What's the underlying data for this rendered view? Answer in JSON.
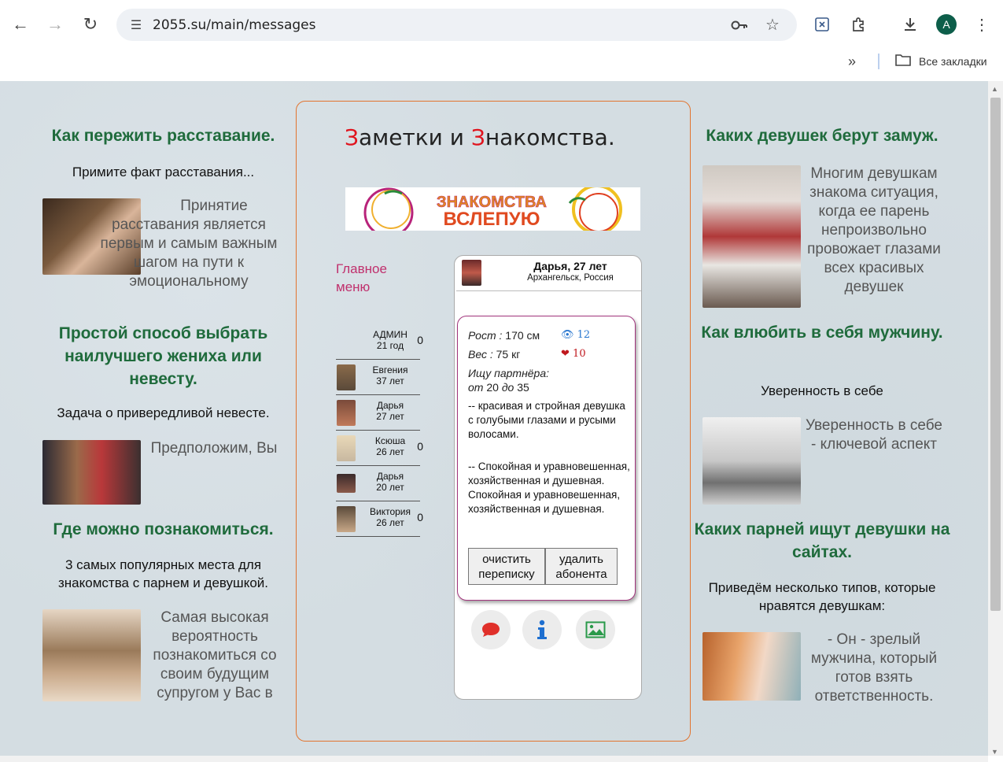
{
  "browser": {
    "url": "2055.su/main/messages",
    "bookmarks_label": "Все закладки",
    "profile_initial": "A"
  },
  "page": {
    "site_title_part1_first": "З",
    "site_title_part1_rest": "аметки и ",
    "site_title_part2_first": "З",
    "site_title_part2_rest": "накомства.",
    "banner_text_line1": "ЗНАКОМСТВА",
    "banner_text_line2": "ВСЛЕПУЮ",
    "main_menu": "Главное меню"
  },
  "left": [
    {
      "title": "Как пережить расставание.",
      "sub": "Примите факт расставания...",
      "text": "Принятие расставания является первым и самым важным шагом на пути к эмоциональному"
    },
    {
      "title": "Простой способ выбрать наилучшего жениха или невесту.",
      "sub": "Задача о привередливой невесте.",
      "text": "Предположим, Вы"
    },
    {
      "title": "Где можно познакомиться.",
      "sub": "3 самых популярных места для знакомства с парнем и девушкой.",
      "text": "Самая высокая вероятность познакомиться со своим будущим супругом у Вас в"
    }
  ],
  "right": [
    {
      "title": "Каких девушек берут замуж.",
      "text": "Многим девушкам знакома ситуация, когда ее парень непроизвольно провожает глазами всех красивых девушек"
    },
    {
      "title": "Как влюбить в себя мужчину.",
      "sub": "Уверенность в себе",
      "text": "Уверенность в себе - ключевой аспект"
    },
    {
      "title": "Каких парней ищут девушки на сайтах.",
      "sub": "Приведём несколько типов, которые нравятся девушкам:",
      "text": "- Он - зрелый мужчина, который готов взять ответственность."
    }
  ],
  "users": [
    {
      "name": "АДМИН",
      "age": "21 год",
      "count": "0"
    },
    {
      "name": "Евгения",
      "age": "37 лет",
      "count": ""
    },
    {
      "name": "Дарья",
      "age": "27 лет",
      "count": ""
    },
    {
      "name": "Ксюша",
      "age": "26 лет",
      "count": "0"
    },
    {
      "name": "Дарья",
      "age": "20 лет",
      "count": ""
    },
    {
      "name": "Виктория",
      "age": "26 лет",
      "count": "0"
    }
  ],
  "profile": {
    "name": "Дарья, 27 лет",
    "city": "Архангельск, Россия",
    "height_label": "Рост :",
    "height_value": " 170 см",
    "weight_label": "Вес :",
    "weight_value": " 75 кг",
    "views": "12",
    "likes": "10",
    "seek_label": "Ищу партнёра:",
    "age_from_label": "от",
    "age_from": "20",
    "age_to_label": "до",
    "age_to": "35",
    "desc1": "-- красивая и стройная девушка с голубыми глазами и русыми волосами.",
    "desc2": "-- Спокойная и уравновешенная, хозяйственная и душевная. Спокойная и уравновешенная, хозяйственная и душевная.",
    "btn_clear": "очистить переписку",
    "btn_delete": "удалить абонента"
  },
  "colors": {
    "accent_red": "#e0141e",
    "title_green": "#1f6b3c",
    "menu_pink": "#c0306d",
    "card_border": "#a2357d"
  }
}
